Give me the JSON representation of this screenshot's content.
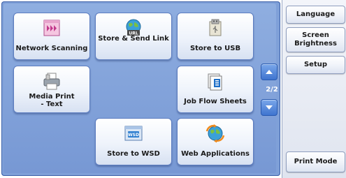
{
  "tiles": {
    "network_scanning": "Network Scanning",
    "store_send_link": "Store & Send Link",
    "store_to_usb": "Store to USB",
    "media_print_line1": "Media Print",
    "media_print_line2": "- Text",
    "job_flow_sheets": "Job Flow Sheets",
    "store_to_wsd": "Store to WSD",
    "web_applications": "Web Applications"
  },
  "icon_text": {
    "url": "URL",
    "wsd": "WSD"
  },
  "pager": {
    "indicator": "2/2"
  },
  "side": {
    "language": "Language",
    "screen_brightness_line1": "Screen",
    "screen_brightness_line2": "Brightness",
    "setup": "Setup",
    "print_mode": "Print Mode"
  },
  "colors": {
    "panel_blue": "#7fa0d8",
    "scroll_button": "#3f74cf",
    "tile_face": "#eef3fb"
  }
}
